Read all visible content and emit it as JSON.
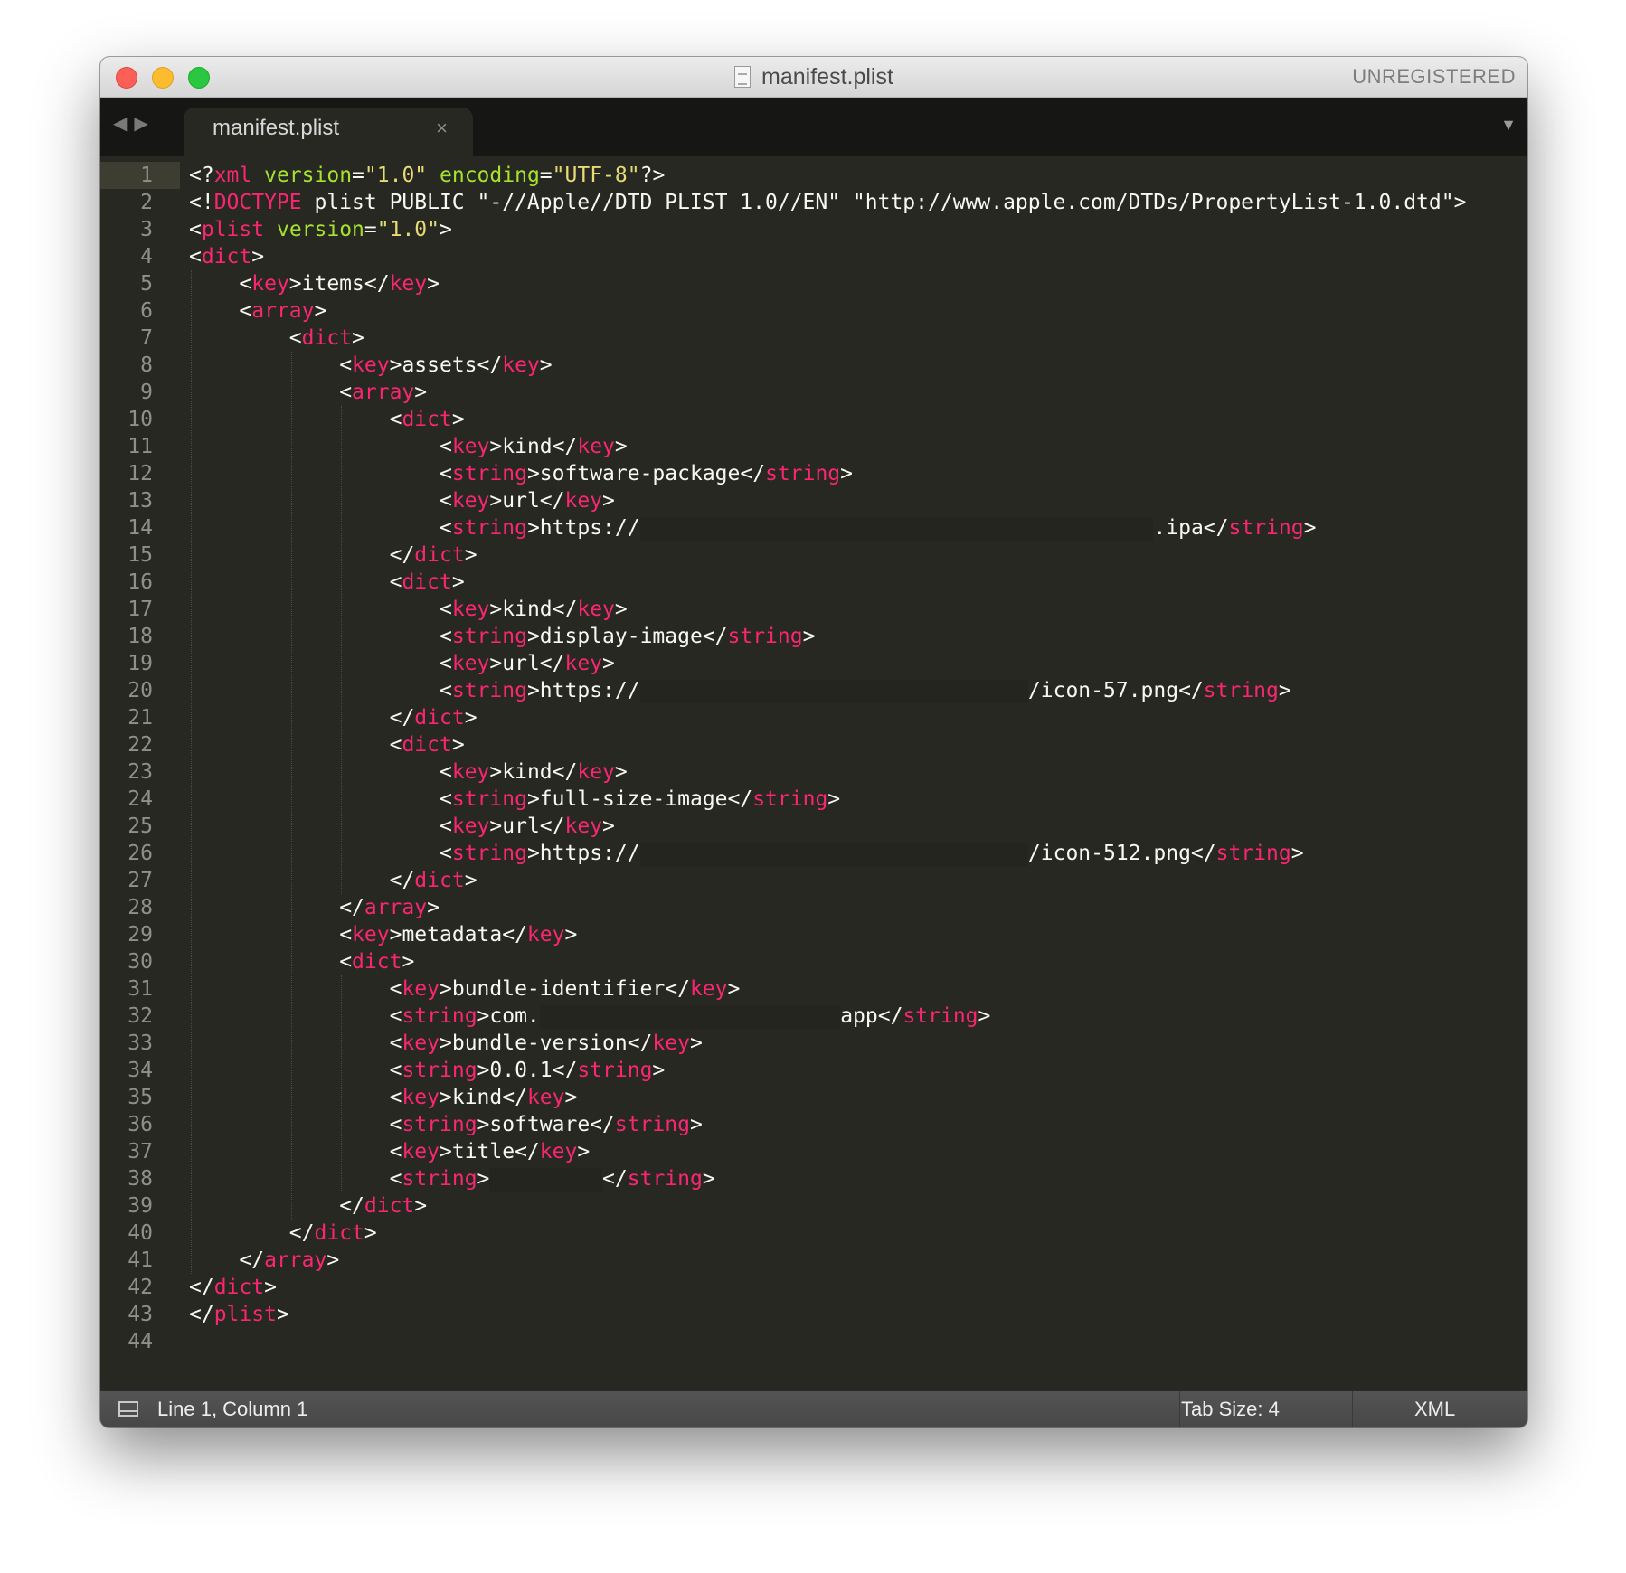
{
  "window": {
    "title": "manifest.plist",
    "license_status": "UNREGISTERED"
  },
  "tabs": [
    {
      "label": "manifest.plist",
      "close_glyph": "×",
      "active": true
    }
  ],
  "icons": {
    "nav_back": "◀",
    "nav_forward": "▶",
    "tab_dropdown": "▼"
  },
  "theme": {
    "background": "#272822",
    "tag": "#f92672",
    "attribute": "#a6e22e",
    "string": "#e6db74",
    "text": "#f8f8f2"
  },
  "editor": {
    "lines": [
      {
        "n": "1",
        "indent": 0,
        "segs": [
          {
            "c": "p",
            "t": "<?"
          },
          {
            "c": "t",
            "t": "xml"
          },
          {
            "c": "p",
            "t": " "
          },
          {
            "c": "a",
            "t": "version"
          },
          {
            "c": "p",
            "t": "="
          },
          {
            "c": "s",
            "t": "\"1.0\""
          },
          {
            "c": "p",
            "t": " "
          },
          {
            "c": "a",
            "t": "encoding"
          },
          {
            "c": "p",
            "t": "="
          },
          {
            "c": "s",
            "t": "\"UTF-8\""
          },
          {
            "c": "p",
            "t": "?>"
          }
        ]
      },
      {
        "n": "2",
        "indent": 0,
        "segs": [
          {
            "c": "p",
            "t": "<!"
          },
          {
            "c": "t",
            "t": "DOCTYPE"
          },
          {
            "c": "p",
            "t": " plist PUBLIC \"-//Apple//DTD PLIST 1.0//EN\" \"http://www.apple.com/DTDs/PropertyList-1.0.dtd\">"
          }
        ]
      },
      {
        "n": "3",
        "indent": 0,
        "segs": [
          {
            "c": "p",
            "t": "<"
          },
          {
            "c": "t",
            "t": "plist"
          },
          {
            "c": "p",
            "t": " "
          },
          {
            "c": "a",
            "t": "version"
          },
          {
            "c": "p",
            "t": "="
          },
          {
            "c": "s",
            "t": "\"1.0\""
          },
          {
            "c": "p",
            "t": ">"
          }
        ]
      },
      {
        "n": "4",
        "indent": 0,
        "segs": [
          {
            "c": "p",
            "t": "<"
          },
          {
            "c": "t",
            "t": "dict"
          },
          {
            "c": "p",
            "t": ">"
          }
        ]
      },
      {
        "n": "5",
        "indent": 1,
        "segs": [
          {
            "c": "p",
            "t": "<"
          },
          {
            "c": "t",
            "t": "key"
          },
          {
            "c": "p",
            "t": ">items</"
          },
          {
            "c": "t",
            "t": "key"
          },
          {
            "c": "p",
            "t": ">"
          }
        ]
      },
      {
        "n": "6",
        "indent": 1,
        "segs": [
          {
            "c": "p",
            "t": "<"
          },
          {
            "c": "t",
            "t": "array"
          },
          {
            "c": "p",
            "t": ">"
          }
        ]
      },
      {
        "n": "7",
        "indent": 2,
        "segs": [
          {
            "c": "p",
            "t": "<"
          },
          {
            "c": "t",
            "t": "dict"
          },
          {
            "c": "p",
            "t": ">"
          }
        ]
      },
      {
        "n": "8",
        "indent": 3,
        "segs": [
          {
            "c": "p",
            "t": "<"
          },
          {
            "c": "t",
            "t": "key"
          },
          {
            "c": "p",
            "t": ">assets</"
          },
          {
            "c": "t",
            "t": "key"
          },
          {
            "c": "p",
            "t": ">"
          }
        ]
      },
      {
        "n": "9",
        "indent": 3,
        "segs": [
          {
            "c": "p",
            "t": "<"
          },
          {
            "c": "t",
            "t": "array"
          },
          {
            "c": "p",
            "t": ">"
          }
        ]
      },
      {
        "n": "10",
        "indent": 4,
        "segs": [
          {
            "c": "p",
            "t": "<"
          },
          {
            "c": "t",
            "t": "dict"
          },
          {
            "c": "p",
            "t": ">"
          }
        ]
      },
      {
        "n": "11",
        "indent": 5,
        "segs": [
          {
            "c": "p",
            "t": "<"
          },
          {
            "c": "t",
            "t": "key"
          },
          {
            "c": "p",
            "t": ">kind</"
          },
          {
            "c": "t",
            "t": "key"
          },
          {
            "c": "p",
            "t": ">"
          }
        ]
      },
      {
        "n": "12",
        "indent": 5,
        "segs": [
          {
            "c": "p",
            "t": "<"
          },
          {
            "c": "t",
            "t": "string"
          },
          {
            "c": "p",
            "t": ">software-package</"
          },
          {
            "c": "t",
            "t": "string"
          },
          {
            "c": "p",
            "t": ">"
          }
        ]
      },
      {
        "n": "13",
        "indent": 5,
        "segs": [
          {
            "c": "p",
            "t": "<"
          },
          {
            "c": "t",
            "t": "key"
          },
          {
            "c": "p",
            "t": ">url</"
          },
          {
            "c": "t",
            "t": "key"
          },
          {
            "c": "p",
            "t": ">"
          }
        ]
      },
      {
        "n": "14",
        "indent": 5,
        "segs": [
          {
            "c": "p",
            "t": "<"
          },
          {
            "c": "t",
            "t": "string"
          },
          {
            "c": "p",
            "t": ">https://"
          },
          {
            "c": "r",
            "w": 41
          },
          {
            "c": "p",
            "t": ".ipa</"
          },
          {
            "c": "t",
            "t": "string"
          },
          {
            "c": "p",
            "t": ">"
          }
        ]
      },
      {
        "n": "15",
        "indent": 4,
        "segs": [
          {
            "c": "p",
            "t": "</"
          },
          {
            "c": "t",
            "t": "dict"
          },
          {
            "c": "p",
            "t": ">"
          }
        ]
      },
      {
        "n": "16",
        "indent": 4,
        "segs": [
          {
            "c": "p",
            "t": "<"
          },
          {
            "c": "t",
            "t": "dict"
          },
          {
            "c": "p",
            "t": ">"
          }
        ]
      },
      {
        "n": "17",
        "indent": 5,
        "segs": [
          {
            "c": "p",
            "t": "<"
          },
          {
            "c": "t",
            "t": "key"
          },
          {
            "c": "p",
            "t": ">kind</"
          },
          {
            "c": "t",
            "t": "key"
          },
          {
            "c": "p",
            "t": ">"
          }
        ]
      },
      {
        "n": "18",
        "indent": 5,
        "segs": [
          {
            "c": "p",
            "t": "<"
          },
          {
            "c": "t",
            "t": "string"
          },
          {
            "c": "p",
            "t": ">display-image</"
          },
          {
            "c": "t",
            "t": "string"
          },
          {
            "c": "p",
            "t": ">"
          }
        ]
      },
      {
        "n": "19",
        "indent": 5,
        "segs": [
          {
            "c": "p",
            "t": "<"
          },
          {
            "c": "t",
            "t": "key"
          },
          {
            "c": "p",
            "t": ">url</"
          },
          {
            "c": "t",
            "t": "key"
          },
          {
            "c": "p",
            "t": ">"
          }
        ]
      },
      {
        "n": "20",
        "indent": 5,
        "segs": [
          {
            "c": "p",
            "t": "<"
          },
          {
            "c": "t",
            "t": "string"
          },
          {
            "c": "p",
            "t": ">https://"
          },
          {
            "c": "r",
            "w": 31
          },
          {
            "c": "p",
            "t": "/icon-57.png</"
          },
          {
            "c": "t",
            "t": "string"
          },
          {
            "c": "p",
            "t": ">"
          }
        ]
      },
      {
        "n": "21",
        "indent": 4,
        "segs": [
          {
            "c": "p",
            "t": "</"
          },
          {
            "c": "t",
            "t": "dict"
          },
          {
            "c": "p",
            "t": ">"
          }
        ]
      },
      {
        "n": "22",
        "indent": 4,
        "segs": [
          {
            "c": "p",
            "t": "<"
          },
          {
            "c": "t",
            "t": "dict"
          },
          {
            "c": "p",
            "t": ">"
          }
        ]
      },
      {
        "n": "23",
        "indent": 5,
        "segs": [
          {
            "c": "p",
            "t": "<"
          },
          {
            "c": "t",
            "t": "key"
          },
          {
            "c": "p",
            "t": ">kind</"
          },
          {
            "c": "t",
            "t": "key"
          },
          {
            "c": "p",
            "t": ">"
          }
        ]
      },
      {
        "n": "24",
        "indent": 5,
        "segs": [
          {
            "c": "p",
            "t": "<"
          },
          {
            "c": "t",
            "t": "string"
          },
          {
            "c": "p",
            "t": ">full-size-image</"
          },
          {
            "c": "t",
            "t": "string"
          },
          {
            "c": "p",
            "t": ">"
          }
        ]
      },
      {
        "n": "25",
        "indent": 5,
        "segs": [
          {
            "c": "p",
            "t": "<"
          },
          {
            "c": "t",
            "t": "key"
          },
          {
            "c": "p",
            "t": ">url</"
          },
          {
            "c": "t",
            "t": "key"
          },
          {
            "c": "p",
            "t": ">"
          }
        ]
      },
      {
        "n": "26",
        "indent": 5,
        "segs": [
          {
            "c": "p",
            "t": "<"
          },
          {
            "c": "t",
            "t": "string"
          },
          {
            "c": "p",
            "t": ">https://"
          },
          {
            "c": "r",
            "w": 31
          },
          {
            "c": "p",
            "t": "/icon-512.png</"
          },
          {
            "c": "t",
            "t": "string"
          },
          {
            "c": "p",
            "t": ">"
          }
        ]
      },
      {
        "n": "27",
        "indent": 4,
        "segs": [
          {
            "c": "p",
            "t": "</"
          },
          {
            "c": "t",
            "t": "dict"
          },
          {
            "c": "p",
            "t": ">"
          }
        ]
      },
      {
        "n": "28",
        "indent": 3,
        "segs": [
          {
            "c": "p",
            "t": "</"
          },
          {
            "c": "t",
            "t": "array"
          },
          {
            "c": "p",
            "t": ">"
          }
        ]
      },
      {
        "n": "29",
        "indent": 3,
        "segs": [
          {
            "c": "p",
            "t": "<"
          },
          {
            "c": "t",
            "t": "key"
          },
          {
            "c": "p",
            "t": ">metadata</"
          },
          {
            "c": "t",
            "t": "key"
          },
          {
            "c": "p",
            "t": ">"
          }
        ]
      },
      {
        "n": "30",
        "indent": 3,
        "segs": [
          {
            "c": "p",
            "t": "<"
          },
          {
            "c": "t",
            "t": "dict"
          },
          {
            "c": "p",
            "t": ">"
          }
        ]
      },
      {
        "n": "31",
        "indent": 4,
        "segs": [
          {
            "c": "p",
            "t": "<"
          },
          {
            "c": "t",
            "t": "key"
          },
          {
            "c": "p",
            "t": ">bundle-identifier</"
          },
          {
            "c": "t",
            "t": "key"
          },
          {
            "c": "p",
            "t": ">"
          }
        ]
      },
      {
        "n": "32",
        "indent": 4,
        "segs": [
          {
            "c": "p",
            "t": "<"
          },
          {
            "c": "t",
            "t": "string"
          },
          {
            "c": "p",
            "t": ">com."
          },
          {
            "c": "r",
            "w": 24
          },
          {
            "c": "p",
            "t": "app</"
          },
          {
            "c": "t",
            "t": "string"
          },
          {
            "c": "p",
            "t": ">"
          }
        ]
      },
      {
        "n": "33",
        "indent": 4,
        "segs": [
          {
            "c": "p",
            "t": "<"
          },
          {
            "c": "t",
            "t": "key"
          },
          {
            "c": "p",
            "t": ">bundle-version</"
          },
          {
            "c": "t",
            "t": "key"
          },
          {
            "c": "p",
            "t": ">"
          }
        ]
      },
      {
        "n": "34",
        "indent": 4,
        "segs": [
          {
            "c": "p",
            "t": "<"
          },
          {
            "c": "t",
            "t": "string"
          },
          {
            "c": "p",
            "t": ">0.0.1</"
          },
          {
            "c": "t",
            "t": "string"
          },
          {
            "c": "p",
            "t": ">"
          }
        ]
      },
      {
        "n": "35",
        "indent": 4,
        "segs": [
          {
            "c": "p",
            "t": "<"
          },
          {
            "c": "t",
            "t": "key"
          },
          {
            "c": "p",
            "t": ">kind</"
          },
          {
            "c": "t",
            "t": "key"
          },
          {
            "c": "p",
            "t": ">"
          }
        ]
      },
      {
        "n": "36",
        "indent": 4,
        "segs": [
          {
            "c": "p",
            "t": "<"
          },
          {
            "c": "t",
            "t": "string"
          },
          {
            "c": "p",
            "t": ">software</"
          },
          {
            "c": "t",
            "t": "string"
          },
          {
            "c": "p",
            "t": ">"
          }
        ]
      },
      {
        "n": "37",
        "indent": 4,
        "segs": [
          {
            "c": "p",
            "t": "<"
          },
          {
            "c": "t",
            "t": "key"
          },
          {
            "c": "p",
            "t": ">title</"
          },
          {
            "c": "t",
            "t": "key"
          },
          {
            "c": "p",
            "t": ">"
          }
        ]
      },
      {
        "n": "38",
        "indent": 4,
        "segs": [
          {
            "c": "p",
            "t": "<"
          },
          {
            "c": "t",
            "t": "string"
          },
          {
            "c": "p",
            "t": ">"
          },
          {
            "c": "r",
            "w": 9
          },
          {
            "c": "p",
            "t": "</"
          },
          {
            "c": "t",
            "t": "string"
          },
          {
            "c": "p",
            "t": ">"
          }
        ]
      },
      {
        "n": "39",
        "indent": 3,
        "segs": [
          {
            "c": "p",
            "t": "</"
          },
          {
            "c": "t",
            "t": "dict"
          },
          {
            "c": "p",
            "t": ">"
          }
        ]
      },
      {
        "n": "40",
        "indent": 2,
        "segs": [
          {
            "c": "p",
            "t": "</"
          },
          {
            "c": "t",
            "t": "dict"
          },
          {
            "c": "p",
            "t": ">"
          }
        ]
      },
      {
        "n": "41",
        "indent": 1,
        "segs": [
          {
            "c": "p",
            "t": "</"
          },
          {
            "c": "t",
            "t": "array"
          },
          {
            "c": "p",
            "t": ">"
          }
        ]
      },
      {
        "n": "42",
        "indent": 0,
        "segs": [
          {
            "c": "p",
            "t": "</"
          },
          {
            "c": "t",
            "t": "dict"
          },
          {
            "c": "p",
            "t": ">"
          }
        ]
      },
      {
        "n": "43",
        "indent": 0,
        "segs": [
          {
            "c": "p",
            "t": "</"
          },
          {
            "c": "t",
            "t": "plist"
          },
          {
            "c": "p",
            "t": ">"
          }
        ]
      },
      {
        "n": "44",
        "indent": 0,
        "segs": []
      }
    ]
  },
  "status": {
    "cursor_position": "Line 1, Column 1",
    "tab_size": "Tab Size: 4",
    "syntax": "XML"
  }
}
